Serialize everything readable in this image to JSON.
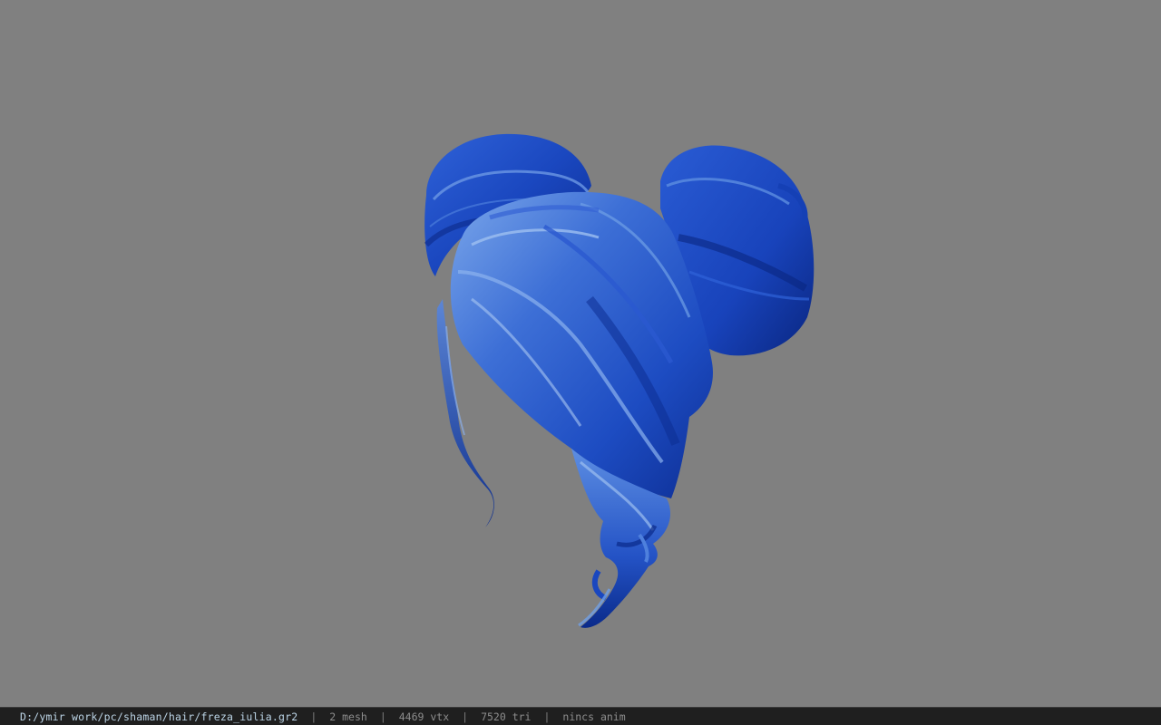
{
  "status_bar": {
    "file_path": "D:/ymir work/pc/shaman/hair/freza_iulia.gr2",
    "separator": "|",
    "mesh_count": "2 mesh",
    "vertex_count": "4469 vtx",
    "triangle_count": "7520 tri",
    "animation_status": "nincs anim"
  },
  "viewport": {
    "background_color": "#808080",
    "model": "blue hair mesh with double buns and curly tails"
  },
  "colors": {
    "hair_dark": "#0a2a8a",
    "hair_mid": "#1c4fc4",
    "hair_light": "#6f9fe6",
    "statusbar_bg": "#1f1f1f",
    "statusbar_path": "#bcd4e6"
  }
}
